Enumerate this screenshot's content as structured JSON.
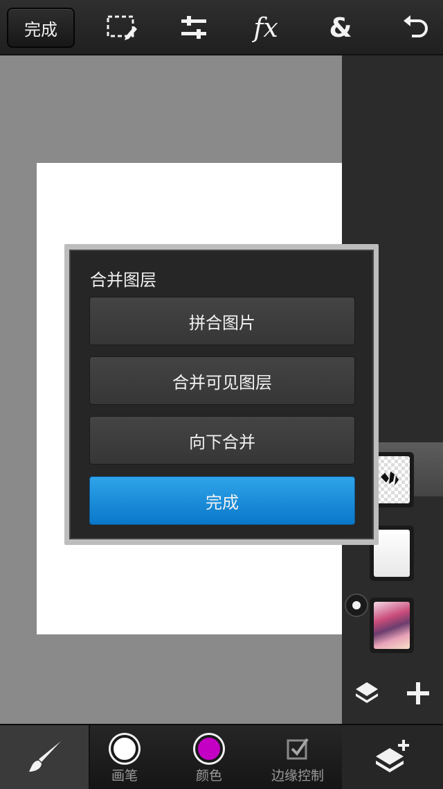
{
  "toolbar": {
    "done_label": "完成",
    "icons": [
      "selection-icon",
      "adjust-icon",
      "fx-icon",
      "ampersand-icon",
      "undo-icon"
    ],
    "fx_text": "fx",
    "amp_text": "&"
  },
  "dialog": {
    "title": "合并图层",
    "buttons": [
      "拼合图片",
      "合并可见图层",
      "向下合并"
    ],
    "confirm_label": "完成",
    "accent": "#1a8fde"
  },
  "bottom": {
    "tools": [
      "画笔",
      "颜色",
      "边缘控制"
    ],
    "color_swatch": "#c400c4"
  }
}
